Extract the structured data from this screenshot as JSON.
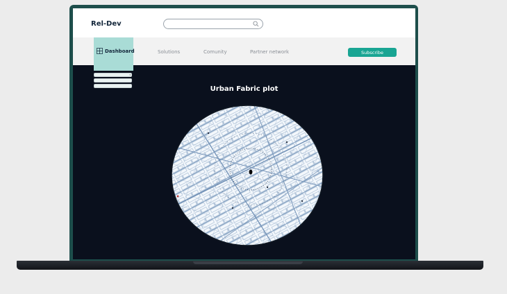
{
  "header": {
    "brand": "Rel-Dev",
    "search_placeholder": ""
  },
  "nav": {
    "dashboard_label": "Dashboard",
    "links": [
      "Solutions",
      "Comunity",
      "Partner network"
    ],
    "subscribe_label": "Subscribe"
  },
  "dropdown": {
    "items": [
      "",
      "",
      ""
    ]
  },
  "main": {
    "plot_title": "Urban Fabric plot"
  },
  "colors": {
    "accent": "#19a593",
    "nav_active": "#a9dcd6",
    "screen_bg": "#0a101d",
    "map_road": "#8ea7c4"
  }
}
